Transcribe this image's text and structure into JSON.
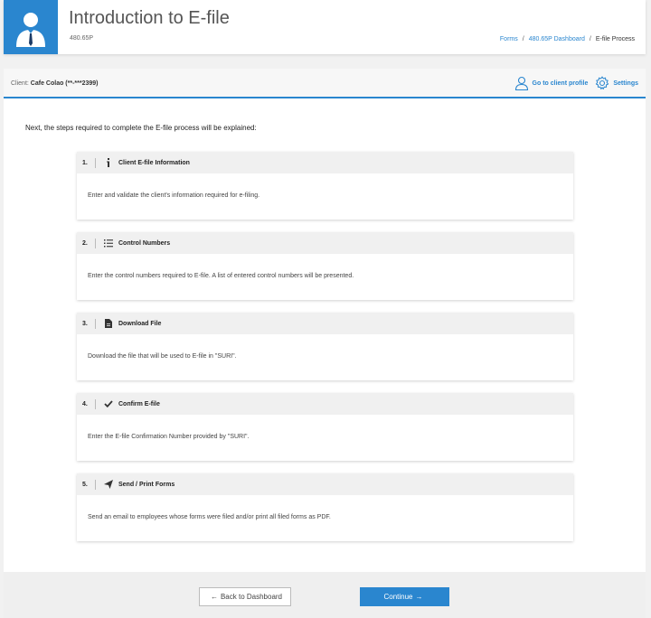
{
  "header": {
    "title": "Introduction to E-file",
    "code": "480.65P",
    "breadcrumb": [
      {
        "label": "Forms"
      },
      {
        "label": "480.65P Dashboard"
      },
      {
        "label": "E-file Process"
      }
    ],
    "separator": "/"
  },
  "client_bar": {
    "label": "Client:",
    "client_name": "Cafe Colao (**-***2399)",
    "go_to_profile": "Go to client profile",
    "settings": "Settings"
  },
  "intro_text": "Next, the steps required to complete the E-file process will be explained:",
  "steps": [
    {
      "number": "1.",
      "icon": "info-icon",
      "title": "Client E-file Information",
      "description": "Enter and validate the client's information required for e-filing."
    },
    {
      "number": "2.",
      "icon": "list-icon",
      "title": "Control Numbers",
      "description": "Enter the control numbers required to E-file. A list of entered control numbers will be presented."
    },
    {
      "number": "3.",
      "icon": "file-icon",
      "title": "Download File",
      "description": "Download the file that will be used to E-file in \"SURI\"."
    },
    {
      "number": "4.",
      "icon": "check-icon",
      "title": "Confirm E-file",
      "description": "Enter the E-file Confirmation Number provided by \"SURI\"."
    },
    {
      "number": "5.",
      "icon": "send-icon",
      "title": "Send / Print Forms",
      "description": "Send an email to employees whose forms were filed and/or print all filed forms as PDF."
    }
  ],
  "footer": {
    "back_label": "Back to Dashboard",
    "continue_label": "Continue"
  },
  "colors": {
    "accent": "#2a86cf"
  }
}
